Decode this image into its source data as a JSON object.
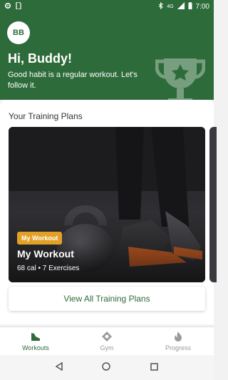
{
  "status_bar": {
    "time": "7:00",
    "network_label": "4G"
  },
  "header": {
    "avatar_initials": "BB",
    "greeting": "Hi, Buddy!",
    "subtitle": "Good habit is a regular workout. Let's follow it."
  },
  "training": {
    "section_title": "Your Training Plans",
    "plans": [
      {
        "tag": "My Workout",
        "title": "My Workout",
        "meta": "68 cal • 7 Exercises"
      }
    ],
    "view_all_label": "View All Training Plans"
  },
  "bottom_nav": {
    "items": [
      {
        "label": "Workouts",
        "icon": "shoe-icon",
        "active": true
      },
      {
        "label": "Gym",
        "icon": "gym-icon",
        "active": false
      },
      {
        "label": "Progress",
        "icon": "flame-icon",
        "active": false
      }
    ]
  },
  "colors": {
    "primary": "#2e6b3a",
    "tag": "#e2a126"
  }
}
